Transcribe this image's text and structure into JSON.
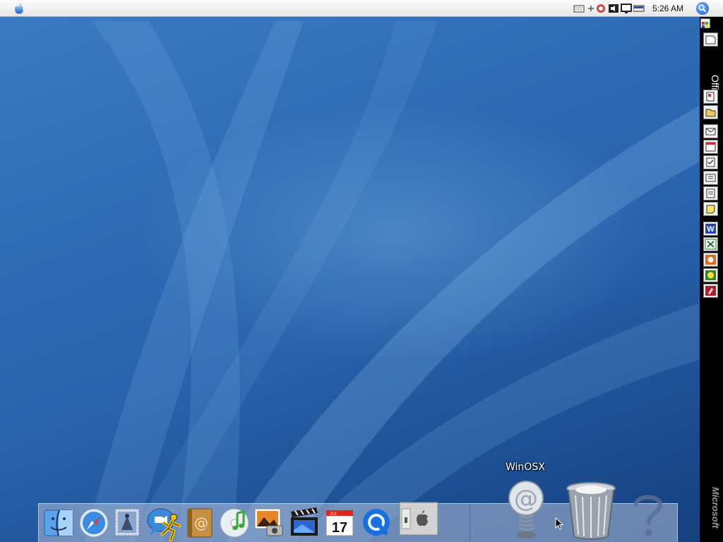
{
  "menubar": {
    "apple_icon": "apple-logo-icon",
    "tray_icons": [
      "keyboard-icon",
      "plus-icon",
      "network-icon",
      "volume-icon",
      "display-icon",
      "battery-icon"
    ],
    "clock": "5:26 AM",
    "search_icon": "spotlight-search-icon"
  },
  "office_bar": {
    "label": "Office",
    "brand": "Microsoft",
    "buttons": [
      "office-menu-icon",
      "folder-icon",
      "new-office-document-icon",
      "open-office-document-icon",
      "new-message-icon",
      "new-appointment-icon",
      "new-task-icon",
      "new-contact-icon",
      "new-journal-entry-icon",
      "new-note-icon",
      "word-icon",
      "excel-icon",
      "powerpoint-icon",
      "publisher-icon",
      "access-icon"
    ]
  },
  "dock": {
    "apps": [
      "finder-icon",
      "safari-icon",
      "mail-icon",
      "ichat-icon",
      "aim-icon",
      "address-book-icon",
      "itunes-icon",
      "iphoto-icon",
      "imovie-icon",
      "ical-icon",
      "quicktime-icon",
      "system-preferences-icon"
    ],
    "ical_month": "JUL",
    "ical_day": "17",
    "right_items": [
      "winosx-internet-icon",
      "trash-icon",
      "help-icon"
    ],
    "tooltip": "WinOSX"
  },
  "colors": {
    "wallpaper": "#2a63ad",
    "menubar": "#f0f0f0",
    "office_bar": "#000000",
    "dock": "#b4c0d6"
  }
}
